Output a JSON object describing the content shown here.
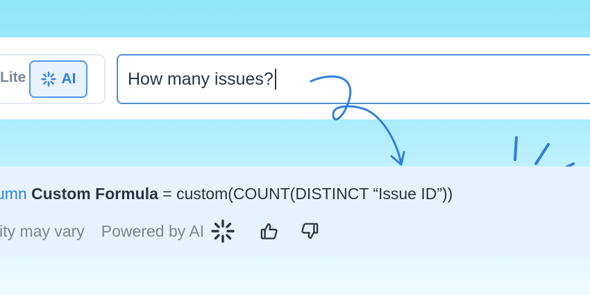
{
  "mode_toggle": {
    "lite_label": "Lite",
    "ai_label": "AI",
    "active": "AI"
  },
  "query": {
    "value": "How many issues?"
  },
  "result": {
    "prefix": "umn",
    "formula_name": "Custom Formula",
    "equals": "=",
    "expression": "custom(COUNT(DISTINCT “Issue ID”))",
    "quality_note": "lity may vary",
    "powered_by": "Powered by AI"
  },
  "icons": {
    "ai_mode": "sparkle-icon",
    "powered": "sparkle-icon",
    "like": "thumbs-up-icon",
    "dislike": "thumbs-down-icon",
    "decor_arrow": "curly-arrow-icon",
    "decor_burst": "burst-lines-icon"
  },
  "colors": {
    "accent": "#2f7fe0",
    "input_border": "#4f8ed9",
    "text": "#2a3442",
    "muted": "#7b8490",
    "panel_bg": "#e6f3fd"
  }
}
